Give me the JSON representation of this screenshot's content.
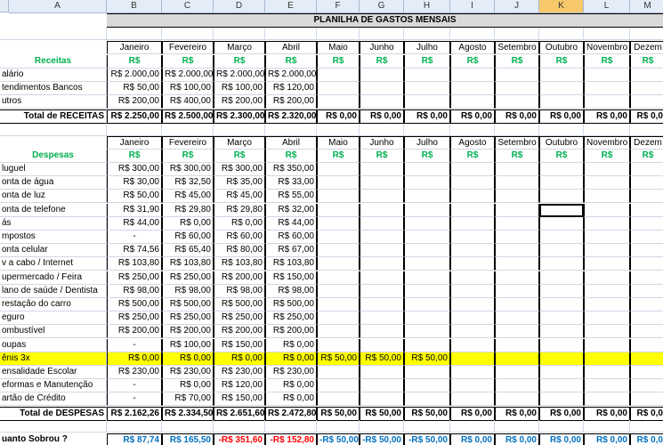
{
  "columns": [
    "A",
    "B",
    "C",
    "D",
    "E",
    "F",
    "G",
    "H",
    "I",
    "J",
    "K",
    "L",
    "M"
  ],
  "title": "PLANILHA DE GASTOS MENSAIS",
  "months": [
    "Janeiro",
    "Fevereiro",
    "Março",
    "Abril",
    "Maio",
    "Junho",
    "Julho",
    "Agosto",
    "Setembro",
    "Outubro",
    "Novembro",
    "Dezem"
  ],
  "currency": "R$",
  "receitas": {
    "label": "Receitas",
    "rows": [
      {
        "label": "alário",
        "values": [
          "R$ 2.000,00",
          "R$ 2.000,00",
          "R$ 2.000,00",
          "R$ 2.000,00",
          "",
          "",
          "",
          "",
          "",
          "",
          "",
          ""
        ]
      },
      {
        "label": "tendimentos Bancos",
        "values": [
          "R$ 50,00",
          "R$ 100,00",
          "R$ 100,00",
          "R$ 120,00",
          "",
          "",
          "",
          "",
          "",
          "",
          "",
          ""
        ]
      },
      {
        "label": "utros",
        "values": [
          "R$ 200,00",
          "R$ 400,00",
          "R$ 200,00",
          "R$ 200,00",
          "",
          "",
          "",
          "",
          "",
          "",
          "",
          ""
        ]
      }
    ],
    "total_label": "Total de RECEITAS",
    "totals": [
      "R$ 2.250,00",
      "R$ 2.500,00",
      "R$ 2.300,00",
      "R$ 2.320,00",
      "R$ 0,00",
      "R$ 0,00",
      "R$ 0,00",
      "R$ 0,00",
      "R$ 0,00",
      "R$ 0,00",
      "R$ 0,00",
      "R$ 0,0"
    ]
  },
  "despesas": {
    "label": "Despesas",
    "rows": [
      {
        "label": "luguel",
        "values": [
          "R$ 300,00",
          "R$ 300,00",
          "R$ 300,00",
          "R$ 350,00",
          "",
          "",
          "",
          "",
          "",
          "",
          "",
          ""
        ]
      },
      {
        "label": "onta de água",
        "values": [
          "R$ 30,00",
          "R$ 32,50",
          "R$ 35,00",
          "R$ 33,00",
          "",
          "",
          "",
          "",
          "",
          "",
          "",
          ""
        ]
      },
      {
        "label": "onta de luz",
        "values": [
          "R$ 50,00",
          "R$ 45,00",
          "R$ 45,00",
          "R$ 55,00",
          "",
          "",
          "",
          "",
          "",
          "",
          "",
          ""
        ]
      },
      {
        "label": "onta de telefone",
        "values": [
          "R$ 31,90",
          "R$ 29,80",
          "R$ 29,80",
          "R$ 32,00",
          "",
          "",
          "",
          "",
          "",
          "",
          "",
          ""
        ]
      },
      {
        "label": "ás",
        "values": [
          "R$ 44,00",
          "R$ 0,00",
          "R$ 0,00",
          "R$ 44,00",
          "",
          "",
          "",
          "",
          "",
          "",
          "",
          ""
        ]
      },
      {
        "label": "mpostos",
        "values": [
          "-",
          "R$ 60,00",
          "R$ 60,00",
          "R$ 60,00",
          "",
          "",
          "",
          "",
          "",
          "",
          "",
          ""
        ]
      },
      {
        "label": "onta celular",
        "values": [
          "R$ 74,56",
          "R$ 65,40",
          "R$ 80,00",
          "R$ 67,00",
          "",
          "",
          "",
          "",
          "",
          "",
          "",
          ""
        ]
      },
      {
        "label": "v a cabo / Internet",
        "values": [
          "R$ 103,80",
          "R$ 103,80",
          "R$ 103,80",
          "R$ 103,80",
          "",
          "",
          "",
          "",
          "",
          "",
          "",
          ""
        ]
      },
      {
        "label": "upermercado / Feira",
        "values": [
          "R$ 250,00",
          "R$ 250,00",
          "R$ 200,00",
          "R$ 150,00",
          "",
          "",
          "",
          "",
          "",
          "",
          "",
          ""
        ]
      },
      {
        "label": "lano de saúde / Dentista",
        "values": [
          "R$ 98,00",
          "R$ 98,00",
          "R$ 98,00",
          "R$ 98,00",
          "",
          "",
          "",
          "",
          "",
          "",
          "",
          ""
        ]
      },
      {
        "label": "restação do carro",
        "values": [
          "R$ 500,00",
          "R$ 500,00",
          "R$ 500,00",
          "R$ 500,00",
          "",
          "",
          "",
          "",
          "",
          "",
          "",
          ""
        ]
      },
      {
        "label": "eguro",
        "values": [
          "R$ 250,00",
          "R$ 250,00",
          "R$ 250,00",
          "R$ 250,00",
          "",
          "",
          "",
          "",
          "",
          "",
          "",
          ""
        ]
      },
      {
        "label": "ombustível",
        "values": [
          "R$ 200,00",
          "R$ 200,00",
          "R$ 200,00",
          "R$ 200,00",
          "",
          "",
          "",
          "",
          "",
          "",
          "",
          ""
        ]
      },
      {
        "label": "oupas",
        "values": [
          "-",
          "R$ 100,00",
          "R$ 150,00",
          "R$ 0,00",
          "",
          "",
          "",
          "",
          "",
          "",
          "",
          ""
        ]
      },
      {
        "label": "ênis 3x",
        "values": [
          "R$ 0,00",
          "R$ 0,00",
          "R$ 0,00",
          "R$ 0,00",
          "R$ 50,00",
          "R$ 50,00",
          "R$ 50,00",
          "",
          "",
          "",
          "",
          ""
        ],
        "highlight": true
      },
      {
        "label": "ensalidade Escolar",
        "values": [
          "R$ 230,00",
          "R$ 230,00",
          "R$ 230,00",
          "R$ 230,00",
          "",
          "",
          "",
          "",
          "",
          "",
          "",
          ""
        ]
      },
      {
        "label": "eformas e Manutenção",
        "values": [
          "-",
          "R$ 0,00",
          "R$ 120,00",
          "R$ 0,00",
          "",
          "",
          "",
          "",
          "",
          "",
          "",
          ""
        ]
      },
      {
        "label": "artão de Crédito",
        "values": [
          "-",
          "R$ 70,00",
          "R$ 150,00",
          "R$ 0,00",
          "",
          "",
          "",
          "",
          "",
          "",
          "",
          ""
        ]
      }
    ],
    "total_label": "Total de DESPESAS",
    "totals": [
      "R$ 2.162,26",
      "R$ 2.334,50",
      "R$ 2.651,60",
      "R$ 2.472,80",
      "R$ 50,00",
      "R$ 50,00",
      "R$ 50,00",
      "R$ 0,00",
      "R$ 0,00",
      "R$ 0,00",
      "R$ 0,00",
      "R$ 0,0"
    ]
  },
  "sobrou": {
    "label": "uanto Sobrou ?",
    "values": [
      "R$ 87,74",
      "R$ 165,50",
      "-R$ 351,60",
      "-R$ 152,80",
      "-R$ 50,00",
      "-R$ 50,00",
      "-R$ 50,00",
      "R$ 0,00",
      "R$ 0,00",
      "R$ 0,00",
      "R$ 0,00",
      "R$ 0,0"
    ],
    "negative": [
      false,
      false,
      true,
      true,
      false,
      false,
      false,
      false,
      false,
      false,
      false,
      false
    ]
  },
  "colors": {
    "header_bg": "#e4ecf7",
    "green": "#00b050",
    "yellow": "#ffff00",
    "blue": "#0070c0",
    "red": "#ff0000",
    "title_bg": "#d9d9d9"
  }
}
